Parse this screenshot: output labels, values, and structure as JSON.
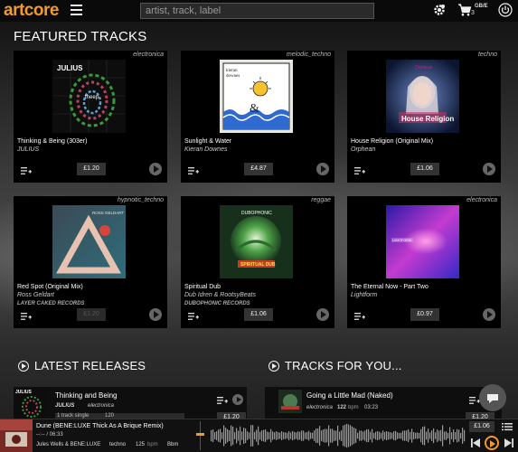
{
  "app": {
    "logo": "artcore"
  },
  "header": {
    "search_placeholder": "artist, track, label",
    "cart_count": "3",
    "currency": "GB/E"
  },
  "featured": {
    "title": "FEATURED TRACKS",
    "tracks": [
      {
        "genre": "electronica",
        "title": "Thinking & Being (303er)",
        "artist": "JULIUS",
        "label": "",
        "price": "£1.20",
        "available": true
      },
      {
        "genre": "melodic_techno",
        "title": "Sunlight & Water",
        "artist": "Kieran Downes",
        "label": "",
        "price": "£4.87",
        "available": true
      },
      {
        "genre": "techno",
        "title": "House Religion (Original Mix)",
        "artist": "Orphean",
        "label": "",
        "price": "£1.06",
        "available": true
      },
      {
        "genre": "hypnotic_techno",
        "title": "Red Spot (Original Mix)",
        "artist": "Ross Geldart",
        "label": "LAYER CAKED RECORDS",
        "price": "£1.20",
        "available": false
      },
      {
        "genre": "reggae",
        "title": "Spiritual Dub",
        "artist": "Dub Idren & RootsyBeats",
        "label": "DUBOPHONIC RECORDS",
        "price": "£1.06",
        "available": true
      },
      {
        "genre": "electronica",
        "title": "The Eternal Now - Part Two",
        "artist": "Lightform",
        "label": "",
        "price": "£0.97",
        "available": true
      }
    ]
  },
  "latest": {
    "title": "LATEST RELEASES",
    "item": {
      "title": "Thinking and Being",
      "artist": "JULIUS",
      "genre": "electronica",
      "meta": "1 track single",
      "bpm": "120",
      "price": "£1.20"
    }
  },
  "foryou": {
    "title": "TRACKS FOR YOU...",
    "item": {
      "title": "Going a Little Mad (Naked)",
      "genre": "electronica",
      "bpm": "122",
      "bpm_unit": "bpm",
      "duration": "03:23",
      "price": "£1.20"
    }
  },
  "player": {
    "track": "Dune (BENE:LUXE Thick As A Brique Remix)",
    "time": "--:-- / 06:33",
    "artists": "Jules Wells & BENE:LUXE",
    "genre": "techno",
    "bpm": "125",
    "bpm_unit": "bpm",
    "key": "Bbm",
    "price": "£1.06"
  }
}
